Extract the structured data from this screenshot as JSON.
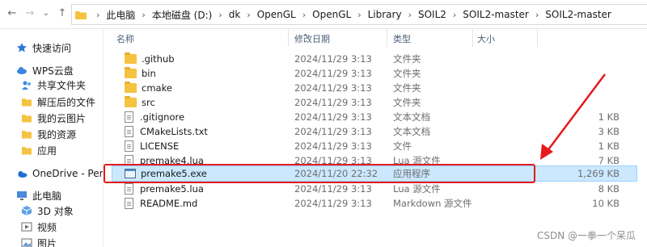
{
  "address_bar": {
    "crumbs": [
      "此电脑",
      "本地磁盘 (D:)",
      "dk",
      "OpenGL",
      "OpenGL",
      "Library",
      "SOIL2",
      "SOIL2-master",
      "SOIL2-master"
    ]
  },
  "sidebar": {
    "items": [
      {
        "label": "快速访问",
        "icon": "star-icon",
        "color": "#2b79d3"
      },
      {
        "label": "WPS云盘",
        "icon": "cloud-icon",
        "color": "#3b86e0"
      },
      {
        "label": "共享文件夹",
        "icon": "share-folder-icon",
        "color": "#3b86e0"
      },
      {
        "label": "解压后的文件",
        "icon": "folder-icon",
        "color": "#f5c342"
      },
      {
        "label": "我的云图片",
        "icon": "folder-icon",
        "color": "#f5c342"
      },
      {
        "label": "我的资源",
        "icon": "folder-icon",
        "color": "#f5c342"
      },
      {
        "label": "应用",
        "icon": "folder-icon",
        "color": "#f5c342"
      },
      {
        "label": "OneDrive - Person",
        "icon": "onedrive-icon",
        "color": "#1c6fd1"
      },
      {
        "label": "此电脑",
        "icon": "computer-icon",
        "color": "#4a89dc"
      },
      {
        "label": "3D 对象",
        "icon": "cube-icon",
        "color": "#5aa0e6"
      },
      {
        "label": "视频",
        "icon": "video-icon",
        "color": "#6b6b6b"
      },
      {
        "label": "图片",
        "icon": "picture-icon",
        "color": "#6b6b6b"
      }
    ]
  },
  "columns": {
    "name": "名称",
    "date": "修改日期",
    "type": "类型",
    "size": "大小"
  },
  "files": [
    {
      "name": ".github",
      "date": "2024/11/29 3:13",
      "type": "文件夹",
      "size": "",
      "icon": "folder-icon"
    },
    {
      "name": "bin",
      "date": "2024/11/29 3:13",
      "type": "文件夹",
      "size": "",
      "icon": "folder-icon"
    },
    {
      "name": "cmake",
      "date": "2024/11/29 3:13",
      "type": "文件夹",
      "size": "",
      "icon": "folder-icon"
    },
    {
      "name": "src",
      "date": "2024/11/29 3:13",
      "type": "文件夹",
      "size": "",
      "icon": "folder-icon"
    },
    {
      "name": ".gitignore",
      "date": "2024/11/29 3:13",
      "type": "文本文档",
      "size": "1 KB",
      "icon": "document-icon"
    },
    {
      "name": "CMakeLists.txt",
      "date": "2024/11/29 3:13",
      "type": "文本文档",
      "size": "3 KB",
      "icon": "document-icon"
    },
    {
      "name": "LICENSE",
      "date": "2024/11/29 3:13",
      "type": "文件",
      "size": "1 KB",
      "icon": "document-icon"
    },
    {
      "name": "premake4.lua",
      "date": "2024/11/29 3:13",
      "type": "Lua 源文件",
      "size": "7 KB",
      "icon": "document-icon"
    },
    {
      "name": "premake5.exe",
      "date": "2024/11/20 22:32",
      "type": "应用程序",
      "size": "1,269 KB",
      "icon": "application-icon",
      "selected": true
    },
    {
      "name": "premake5.lua",
      "date": "2024/11/29 3:13",
      "type": "Lua 源文件",
      "size": "8 KB",
      "icon": "document-icon"
    },
    {
      "name": "README.md",
      "date": "2024/11/29 3:13",
      "type": "Markdown 源文件",
      "size": "10 KB",
      "icon": "document-icon"
    }
  ],
  "annotation": {
    "color": "#e51a1a"
  },
  "watermark": "CSDN @一拳一个呆瓜"
}
